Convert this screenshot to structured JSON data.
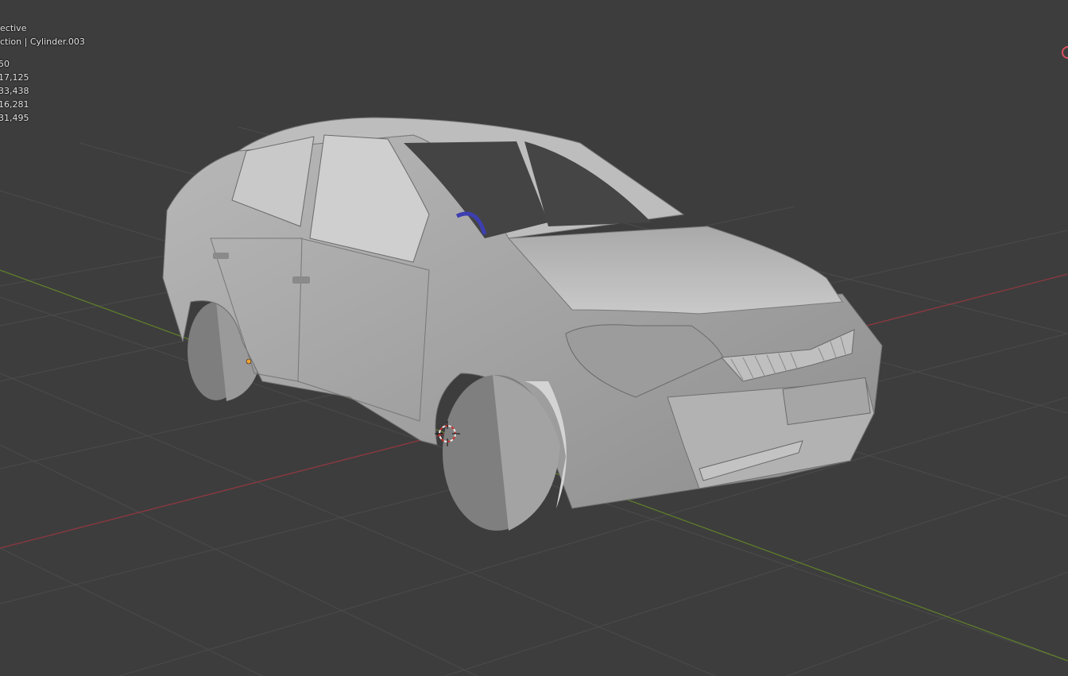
{
  "overlay": {
    "view_mode": "ective",
    "collection_line": "ction | Cylinder.003",
    "stats": [
      "50",
      "17,125",
      "33,438",
      "16,281",
      "31,495"
    ]
  },
  "colors": {
    "background": "#3d3d3d",
    "grid": "#4a4a4a",
    "axis_x": "#9a3a43",
    "axis_y": "#6b8a2e",
    "car_body": "#a7a7a7",
    "steering_wheel": "#3d3fb0",
    "cursor_red": "#c8332e"
  },
  "icons": [
    "3d-cursor-icon",
    "axis-gizmo-x-icon",
    "origin-point-icon"
  ]
}
